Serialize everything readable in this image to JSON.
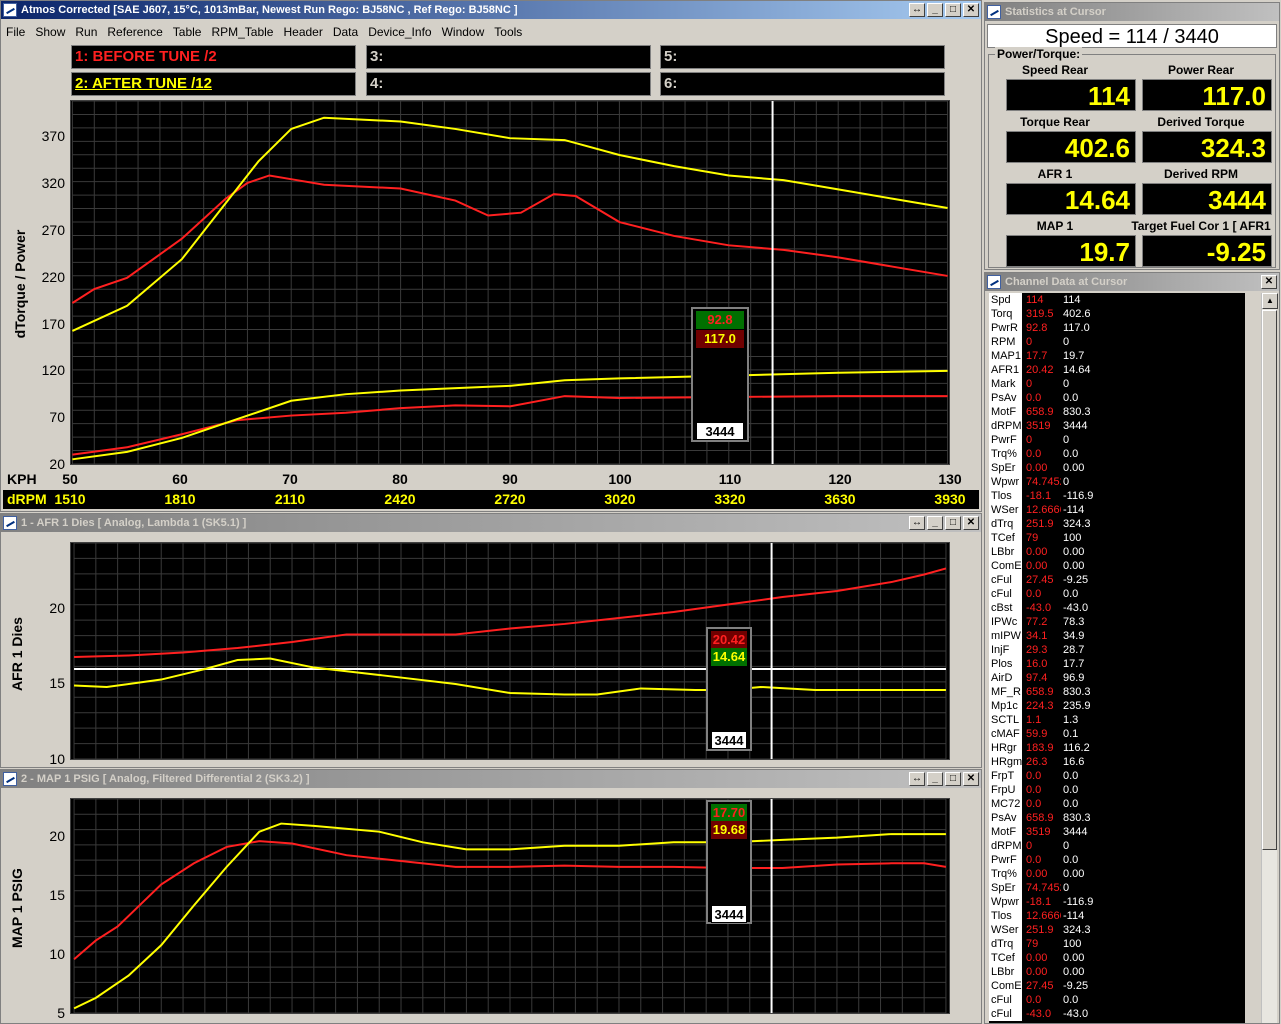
{
  "main": {
    "title": "Atmos Corrected [SAE J607, 15°C, 1013mBar,  Newest Run Rego: BJ58NC ,  Ref Rego: BJ58NC ]",
    "menu": [
      "File",
      "Show",
      "Run",
      "Reference",
      "Table",
      "RPM_Table",
      "Header",
      "Data",
      "Device_Info",
      "Window",
      "Tools"
    ],
    "legend": [
      "1:    BEFORE TUNE /2",
      "2:    AFTER TUNE /12",
      "3:",
      "4:",
      "5:",
      "6:"
    ],
    "ylabel": "dTorque / Power",
    "yticks": [
      "370",
      "320",
      "270",
      "220",
      "170",
      "120",
      "70",
      "20"
    ],
    "xlabel": "KPH",
    "xticks": [
      "50",
      "60",
      "70",
      "80",
      "90",
      "100",
      "110",
      "120",
      "130"
    ],
    "rpmlabel": "dRPM",
    "rpmticks": [
      "1510",
      "1810",
      "2110",
      "2420",
      "2720",
      "3020",
      "3320",
      "3630",
      "3930"
    ],
    "cursor": {
      "v1": "92.8",
      "v2": "117.0",
      "rpm": "3444"
    }
  },
  "afr": {
    "title": "1 - AFR 1 Dies     [ Analog, Lambda 1 (SK5.1) ]",
    "ylabel": "AFR 1 Dies",
    "yticks": [
      "20",
      "15",
      "10"
    ],
    "cursor": {
      "v1": "20.42",
      "v2": "14.64",
      "rpm": "3444"
    }
  },
  "map": {
    "title": "2 - MAP 1 PSIG     [ Analog, Filtered Differential 2 (SK3.2) ]",
    "ylabel": "MAP 1 PSIG",
    "yticks": [
      "20",
      "15",
      "10",
      "5"
    ],
    "cursor": {
      "v1": "17.70",
      "v2": "19.68",
      "rpm": "3444"
    }
  },
  "stats": {
    "title": "Statistics at Cursor",
    "speed": "Speed = 114 / 3440",
    "group": "Power/Torque:",
    "cells": [
      {
        "label": "Speed Rear",
        "value": "114"
      },
      {
        "label": "Power Rear",
        "value": "117.0"
      },
      {
        "label": "Torque Rear",
        "value": "402.6"
      },
      {
        "label": "Derived Torque",
        "value": "324.3"
      },
      {
        "label": "AFR 1",
        "value": "14.64"
      },
      {
        "label": "Derived RPM",
        "value": "3444"
      },
      {
        "label": "MAP 1",
        "value": "19.7"
      },
      {
        "label": "Target Fuel Cor 1 [ AFR1",
        "value": "-9.25"
      }
    ]
  },
  "channels": {
    "title": "Channel Data at Cursor",
    "rows": [
      [
        "Spd",
        "114",
        "114"
      ],
      [
        "Torq",
        "319.5",
        "402.6"
      ],
      [
        "PwrR",
        "92.8",
        "117.0"
      ],
      [
        "RPM",
        "0",
        "0"
      ],
      [
        "MAP1",
        "17.7",
        "19.7"
      ],
      [
        "AFR1",
        "20.42",
        "14.64"
      ],
      [
        "Mark",
        "0",
        "0"
      ],
      [
        "PsAv",
        "0.0",
        "0.0"
      ],
      [
        "MotF",
        "658.9",
        "830.3"
      ],
      [
        "dRPM",
        "3519",
        "3444"
      ],
      [
        "PwrF",
        "0",
        "0"
      ],
      [
        "Trq%",
        "0.0",
        "0.0"
      ],
      [
        "SpEr",
        "0.00",
        "0.00"
      ],
      [
        "Wpwr",
        "74.7452",
        "0"
      ],
      [
        "Tlos",
        "-18.1",
        "-116.9"
      ],
      [
        "WSer",
        "12.6666",
        "-114"
      ],
      [
        "dTrq",
        "251.9",
        "324.3"
      ],
      [
        "TCef",
        "79",
        "100"
      ],
      [
        "LBbr",
        "0.00",
        "0.00"
      ],
      [
        "ComE",
        "0.00",
        "0.00"
      ],
      [
        "cFul",
        "27.45",
        "-9.25"
      ],
      [
        "cFul",
        "0.0",
        "0.0"
      ],
      [
        "cBst",
        "-43.0",
        "-43.0"
      ],
      [
        "IPWc",
        "77.2",
        "78.3"
      ],
      [
        "mIPW",
        "34.1",
        "34.9"
      ],
      [
        "InjF",
        "29.3",
        "28.7"
      ],
      [
        "Plos",
        "16.0",
        "17.7"
      ],
      [
        "AirD",
        "97.4",
        "96.9"
      ],
      [
        "MF_R",
        "658.9",
        "830.3"
      ],
      [
        "Mp1c",
        "224.3",
        "235.9"
      ],
      [
        "SCTL",
        "1.1",
        "1.3"
      ],
      [
        "cMAF",
        "59.9",
        "0.1"
      ],
      [
        "HRgr",
        "183.9",
        "116.2"
      ],
      [
        "HRgm",
        "26.3",
        "16.6"
      ],
      [
        "FrpT",
        "0.0",
        "0.0"
      ],
      [
        "FrpU",
        "0.0",
        "0.0"
      ],
      [
        "MC72",
        "0.0",
        "0.0"
      ],
      [
        "PsAv",
        "658.9",
        "830.3"
      ],
      [
        "MotF",
        "3519",
        "3444"
      ],
      [
        "dRPM",
        "0",
        "0"
      ],
      [
        "PwrF",
        "0.0",
        "0.0"
      ],
      [
        "Trq%",
        "0.00",
        "0.00"
      ],
      [
        "SpEr",
        "74.7452",
        "0"
      ],
      [
        "Wpwr",
        "-18.1",
        "-116.9"
      ],
      [
        "Tlos",
        "12.6666",
        "-114"
      ],
      [
        "WSer",
        "251.9",
        "324.3"
      ],
      [
        "dTrq",
        "79",
        "100"
      ],
      [
        "TCef",
        "0.00",
        "0.00"
      ],
      [
        "LBbr",
        "0.00",
        "0.00"
      ],
      [
        "ComE",
        "27.45",
        "-9.25"
      ],
      [
        "cFul",
        "0.0",
        "0.0"
      ],
      [
        "cFul",
        "-43.0",
        "-43.0"
      ]
    ]
  },
  "series": {
    "main_before_power": [
      [
        50,
        30
      ],
      [
        55,
        38
      ],
      [
        60,
        52
      ],
      [
        65,
        67
      ],
      [
        70,
        72
      ],
      [
        75,
        75
      ],
      [
        80,
        80
      ],
      [
        85,
        83
      ],
      [
        90,
        82
      ],
      [
        95,
        93
      ],
      [
        100,
        91
      ],
      [
        110,
        92
      ],
      [
        120,
        93
      ],
      [
        130,
        93
      ]
    ],
    "main_after_power": [
      [
        50,
        25
      ],
      [
        55,
        33
      ],
      [
        60,
        48
      ],
      [
        65,
        68
      ],
      [
        70,
        88
      ],
      [
        75,
        95
      ],
      [
        80,
        99
      ],
      [
        90,
        104
      ],
      [
        95,
        110
      ],
      [
        100,
        112
      ],
      [
        110,
        115
      ],
      [
        120,
        118
      ],
      [
        130,
        120
      ]
    ],
    "main_before_torque": [
      [
        50,
        193
      ],
      [
        52,
        208
      ],
      [
        55,
        220
      ],
      [
        60,
        262
      ],
      [
        64,
        305
      ],
      [
        66,
        322
      ],
      [
        68,
        330
      ],
      [
        70,
        326
      ],
      [
        73,
        320
      ],
      [
        80,
        316
      ],
      [
        85,
        303
      ],
      [
        88,
        287
      ],
      [
        91,
        290
      ],
      [
        94,
        310
      ],
      [
        96,
        308
      ],
      [
        100,
        280
      ],
      [
        105,
        265
      ],
      [
        110,
        255
      ],
      [
        115,
        250
      ],
      [
        120,
        242
      ],
      [
        125,
        232
      ],
      [
        130,
        222
      ]
    ],
    "main_after_torque": [
      [
        50,
        163
      ],
      [
        55,
        190
      ],
      [
        60,
        240
      ],
      [
        65,
        315
      ],
      [
        67,
        345
      ],
      [
        70,
        380
      ],
      [
        73,
        392
      ],
      [
        80,
        388
      ],
      [
        85,
        380
      ],
      [
        90,
        370
      ],
      [
        95,
        368
      ],
      [
        100,
        352
      ],
      [
        105,
        340
      ],
      [
        110,
        330
      ],
      [
        115,
        325
      ],
      [
        120,
        315
      ],
      [
        125,
        305
      ],
      [
        130,
        295
      ]
    ],
    "afr_before": [
      [
        50,
        16.8
      ],
      [
        55,
        16.9
      ],
      [
        60,
        17.1
      ],
      [
        65,
        17.4
      ],
      [
        70,
        17.8
      ],
      [
        75,
        18.3
      ],
      [
        80,
        18.3
      ],
      [
        85,
        18.3
      ],
      [
        90,
        18.7
      ],
      [
        95,
        19.0
      ],
      [
        100,
        19.4
      ],
      [
        105,
        19.8
      ],
      [
        110,
        20.3
      ],
      [
        115,
        20.8
      ],
      [
        120,
        21.2
      ],
      [
        125,
        21.8
      ],
      [
        128,
        22.3
      ],
      [
        130,
        22.7
      ]
    ],
    "afr_after": [
      [
        50,
        14.9
      ],
      [
        53,
        14.8
      ],
      [
        58,
        15.3
      ],
      [
        62,
        16.0
      ],
      [
        65,
        16.6
      ],
      [
        68,
        16.7
      ],
      [
        72,
        16.1
      ],
      [
        78,
        15.6
      ],
      [
        85,
        15.0
      ],
      [
        90,
        14.4
      ],
      [
        95,
        14.3
      ],
      [
        98,
        14.3
      ],
      [
        102,
        14.7
      ],
      [
        107,
        14.6
      ],
      [
        110,
        14.6
      ],
      [
        113,
        14.8
      ],
      [
        118,
        14.6
      ],
      [
        125,
        14.6
      ],
      [
        130,
        14.6
      ]
    ],
    "map_before": [
      [
        50,
        9.6
      ],
      [
        52,
        11.2
      ],
      [
        54,
        12.4
      ],
      [
        56,
        14.2
      ],
      [
        58,
        16.0
      ],
      [
        61,
        17.8
      ],
      [
        64,
        19.2
      ],
      [
        67,
        19.7
      ],
      [
        70,
        19.5
      ],
      [
        75,
        18.5
      ],
      [
        80,
        18.0
      ],
      [
        85,
        17.5
      ],
      [
        90,
        17.5
      ],
      [
        95,
        17.6
      ],
      [
        100,
        17.5
      ],
      [
        105,
        17.5
      ],
      [
        110,
        17.4
      ],
      [
        115,
        17.4
      ],
      [
        120,
        17.7
      ],
      [
        125,
        17.8
      ],
      [
        128,
        17.8
      ],
      [
        130,
        17.5
      ]
    ],
    "map_after": [
      [
        50,
        5.4
      ],
      [
        52,
        6.3
      ],
      [
        55,
        8.2
      ],
      [
        58,
        10.8
      ],
      [
        61,
        14.2
      ],
      [
        64,
        17.5
      ],
      [
        67,
        20.5
      ],
      [
        69,
        21.2
      ],
      [
        72,
        21.0
      ],
      [
        78,
        20.5
      ],
      [
        82,
        19.6
      ],
      [
        86,
        19.0
      ],
      [
        90,
        19.0
      ],
      [
        95,
        19.3
      ],
      [
        100,
        19.3
      ],
      [
        105,
        19.6
      ],
      [
        110,
        19.6
      ],
      [
        115,
        19.8
      ],
      [
        120,
        20.0
      ],
      [
        125,
        20.3
      ],
      [
        130,
        20.3
      ]
    ]
  }
}
